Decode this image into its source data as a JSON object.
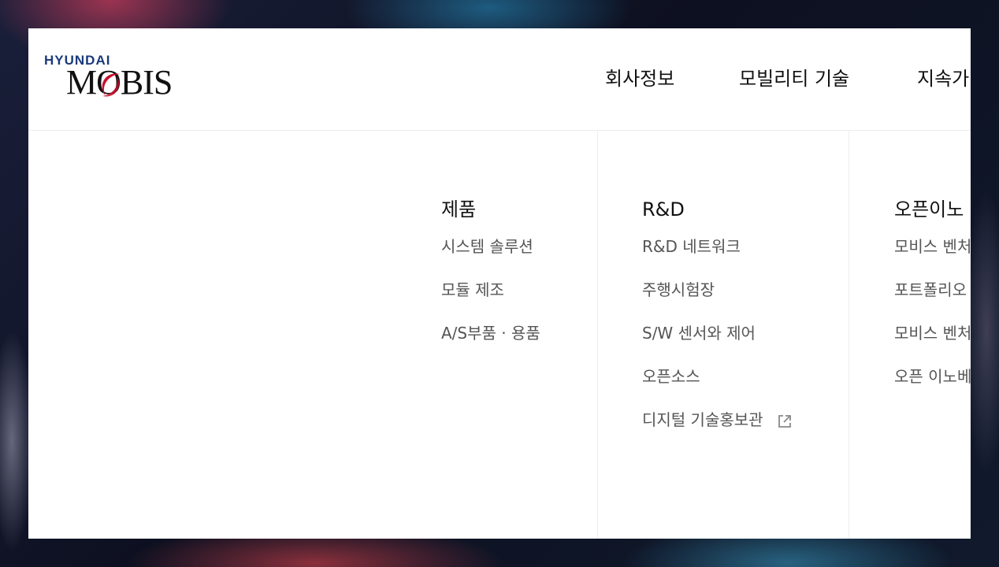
{
  "logo": {
    "brand_top": "HYUNDAI",
    "brand_main": "MOBIS",
    "brand_red": "#c8102e",
    "brand_blue": "#1a3a7a"
  },
  "nav": {
    "items": [
      {
        "label": "회사정보"
      },
      {
        "label": "모빌리티 기술"
      },
      {
        "label": "지속가"
      }
    ]
  },
  "mega_menu": {
    "columns": [
      {
        "title": "제품",
        "items": [
          {
            "label": "시스템 솔루션"
          },
          {
            "label": "모듈 제조"
          },
          {
            "label": "A/S부품 · 용품"
          }
        ]
      },
      {
        "title": "R&D",
        "items": [
          {
            "label": "R&D 네트워크"
          },
          {
            "label": "주행시험장"
          },
          {
            "label": "S/W 센서와 제어"
          },
          {
            "label": "오픈소스"
          },
          {
            "label": "디지털 기술홍보관",
            "icon": "external-link-icon"
          }
        ]
      },
      {
        "title": "오픈이노",
        "items": [
          {
            "label": "모비스 벤처"
          },
          {
            "label": "포트폴리오"
          },
          {
            "label": "모비스 벤처"
          },
          {
            "label": "오픈 이노베"
          }
        ]
      }
    ]
  }
}
